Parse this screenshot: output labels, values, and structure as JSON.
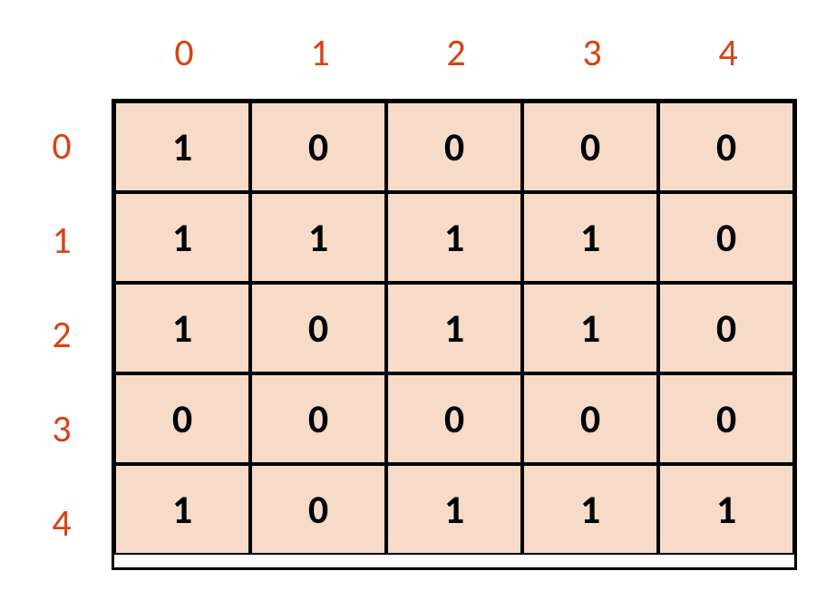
{
  "col_labels": [
    "0",
    "1",
    "2",
    "3",
    "4"
  ],
  "row_labels": [
    "0",
    "1",
    "2",
    "3",
    "4"
  ],
  "matrix": [
    [
      "1",
      "0",
      "0",
      "0",
      "0"
    ],
    [
      "1",
      "1",
      "1",
      "1",
      "0"
    ],
    [
      "1",
      "0",
      "1",
      "1",
      "0"
    ],
    [
      "0",
      "0",
      "0",
      "0",
      "0"
    ],
    [
      "1",
      "0",
      "1",
      "1",
      "1"
    ]
  ]
}
